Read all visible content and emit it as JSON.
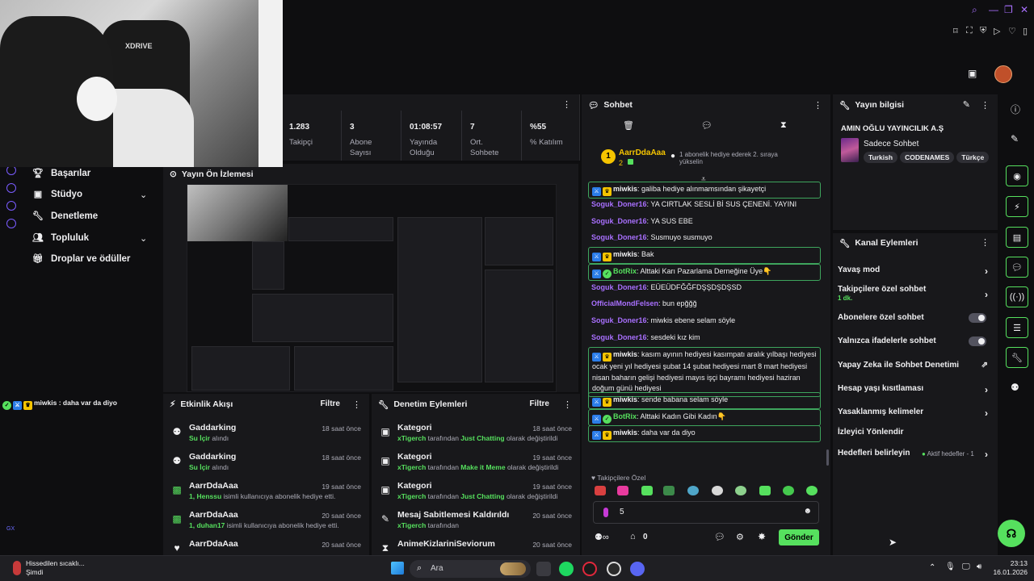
{
  "stats": [
    {
      "value": "1.283",
      "label": "Takipçi"
    },
    {
      "value": "3",
      "label": "Abone Sayısı"
    },
    {
      "value": "01:08:57",
      "label": "Yayında Olduğu"
    },
    {
      "value": "7",
      "label": "Ort. Sohbete"
    },
    {
      "value": "%55",
      "label": "% Katılım"
    }
  ],
  "nav": {
    "items": [
      {
        "label": "Başarılar",
        "icon": "trophy-icon"
      },
      {
        "label": "Stüdyo",
        "icon": "camera-icon"
      },
      {
        "label": "Denetleme",
        "icon": "wrench-icon"
      },
      {
        "label": "Topluluk",
        "icon": "people-icon"
      },
      {
        "label": "Droplar ve ödüller",
        "icon": "gift-icon"
      }
    ],
    "mini_chat": "miwkis : daha var da diyo",
    "rail_label": "GX"
  },
  "preview": {
    "title": "Yayın Ön İzlemesi"
  },
  "feed": {
    "title": "Etkinlik Akışı",
    "filter": "Filtre",
    "items": [
      {
        "name": "Gaddarking",
        "highlight": "Su İçir",
        "rest": " alındı",
        "time": "18 saat önce"
      },
      {
        "name": "Gaddarking",
        "highlight": "Su İçir",
        "rest": " alındı",
        "time": "18 saat önce"
      },
      {
        "name": "AarrDdaAaa",
        "highlight": "1, Henssu",
        "rest": " isimli kullanıcıya abonelik hediye etti.",
        "time": "19 saat önce"
      },
      {
        "name": "AarrDdaAaa",
        "highlight": "1, duhan17",
        "rest": " isimli kullanıcıya abonelik hediye etti.",
        "time": "20 saat önce"
      },
      {
        "name": "AarrDdaAaa",
        "highlight": "",
        "rest": "",
        "time": "20 saat önce"
      }
    ]
  },
  "mod": {
    "title": "Denetim Eylemleri",
    "filter": "Filtre",
    "items": [
      {
        "name": "Kategori",
        "who": "xTigerch",
        "mid": " tarafından ",
        "what": "Just Chatting",
        "end": " olarak değiştirildi",
        "time": "18 saat önce"
      },
      {
        "name": "Kategori",
        "who": "xTigerch",
        "mid": " tarafından ",
        "what": "Make it Meme",
        "end": " olarak değiştirildi",
        "time": "19 saat önce"
      },
      {
        "name": "Kategori",
        "who": "xTigerch",
        "mid": " tarafından ",
        "what": "Just Chatting",
        "end": " olarak değiştirildi",
        "time": "19 saat önce"
      },
      {
        "name": "Mesaj Sabitlemesi Kaldırıldı",
        "who": "xTigerch",
        "mid": " tarafından",
        "what": "",
        "end": "",
        "time": "20 saat önce"
      },
      {
        "name": "AnimeKizlariniSeviorum",
        "who": "",
        "mid": "",
        "what": "",
        "end": "",
        "time": "20 saat önce"
      }
    ]
  },
  "chat": {
    "title": "Sohbet",
    "leader": {
      "rank": "1",
      "name": "AarrDdaAaa",
      "count": "2",
      "note": "1 abonelik hediye ederek 2. sıraya yükselin"
    },
    "messages": [
      {
        "nick": "miwkis",
        "type": "w",
        "badges": true,
        "box": true,
        "text": "galiba hediye alınmamsından şikayetçi"
      },
      {
        "nick": "Soguk_Doner16",
        "type": "p",
        "badges": false,
        "box": false,
        "text": "YA CIRTLAK SESLİ Bİ SUS ÇENENİ. YAYINI"
      },
      {
        "nick": "Soguk_Doner16",
        "type": "p",
        "badges": false,
        "box": false,
        "text": "YA SUS EBE"
      },
      {
        "nick": "Soguk_Doner16",
        "type": "p",
        "badges": false,
        "box": false,
        "text": "Susmuyo susmuyo"
      },
      {
        "nick": "miwkis",
        "type": "w",
        "badges": true,
        "box": true,
        "text": "Bak"
      },
      {
        "nick": "BotRix",
        "type": "g",
        "badges": true,
        "box": true,
        "text": "Alttaki Karı Pazarlama Derneğine Üye👇"
      },
      {
        "nick": "Soguk_Doner16",
        "type": "p",
        "badges": false,
        "box": false,
        "text": "EÜEÜDFĞĞFDŞŞDŞDŞSD"
      },
      {
        "nick": "OfficialMondFelsen",
        "type": "p",
        "badges": false,
        "box": false,
        "text": "bun epğğğ"
      },
      {
        "nick": "Soguk_Doner16",
        "type": "p",
        "badges": false,
        "box": false,
        "text": "miwkis ebene selam söyle"
      },
      {
        "nick": "Soguk_Doner16",
        "type": "p",
        "badges": false,
        "box": false,
        "text": "sesdeki kız kim"
      },
      {
        "nick": "miwkis",
        "type": "w",
        "badges": true,
        "box": true,
        "text": "kasım ayının hediyesi kasımpatı aralık yılbaşı hediyesi ocak yeni yıl hediyesi şubat 14 şubat hediyesi mart 8 mart hediyesi nisan baharın gelişi hediyesi mayıs işçi bayramı hediyesi haziran doğum günü hediyesi"
      },
      {
        "nick": "miwkis",
        "type": "w",
        "badges": true,
        "box": true,
        "text": "sende babana selam söyle"
      },
      {
        "nick": "BotRix",
        "type": "g",
        "badges": true,
        "box": true,
        "text": "Alttaki Kadın Gibi Kadın👇"
      },
      {
        "nick": "miwkis",
        "type": "w",
        "badges": true,
        "box": true,
        "text": "daha var da diyo"
      }
    ],
    "emote_label": "Takipçilere Özel",
    "input_value": "5",
    "points": "0",
    "send": "Gönder"
  },
  "info": {
    "title": "Yayın bilgisi",
    "channel": "AMIN OĞLU YAYINCILIK A.Ş",
    "category": "Sadece Sohbet",
    "tags": [
      "Turkish",
      "CODENAMES",
      "Türkçe"
    ]
  },
  "actions": {
    "title": "Kanal Eylemleri",
    "items": [
      {
        "label": "Yavaş mod",
        "kind": "chev",
        "sub": ""
      },
      {
        "label": "Takipçilere özel sohbet",
        "kind": "chev",
        "sub": "1 dk."
      },
      {
        "label": "Abonelere özel sohbet",
        "kind": "toggle",
        "sub": ""
      },
      {
        "label": "Yalnızca ifadelerle sohbet",
        "kind": "toggle",
        "sub": ""
      },
      {
        "label": "Yapay Zeka ile Sohbet Denetimi",
        "kind": "ext",
        "sub": ""
      },
      {
        "label": "Hesap yaşı kısıtlaması",
        "kind": "chev",
        "sub": ""
      },
      {
        "label": "Yasaklanmış kelimeler",
        "kind": "chev",
        "sub": ""
      },
      {
        "label": "İzleyici Yönlendir",
        "kind": "none",
        "sub": ""
      },
      {
        "label": "Hedefleri belirleyin",
        "kind": "chev",
        "sub": ""
      }
    ],
    "goals_status": "Aktif hedefler - 1"
  },
  "taskbar": {
    "weather_title": "Hissedilen sıcaklı...",
    "weather_sub": "Şimdi",
    "search": "Ara",
    "time": "23:13",
    "date": "16.01.2026"
  },
  "colors": {
    "accent": "#56e05e",
    "purple": "#a970ff",
    "panel": "#18181b"
  }
}
